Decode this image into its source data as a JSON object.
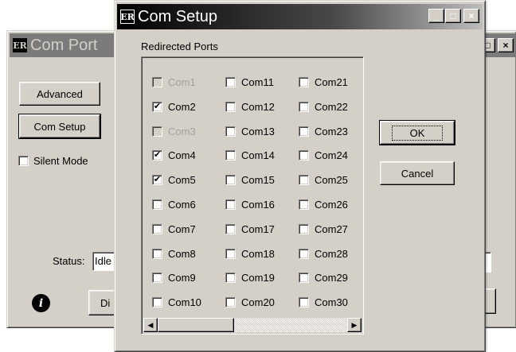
{
  "com_port_window": {
    "title": "Com Port",
    "buttons": {
      "advanced": "Advanced",
      "com_setup": "Com Setup",
      "disconnect_partial": "Di"
    },
    "silent_mode_label": "Silent Mode",
    "status_label": "Status:",
    "status_value": "Idle"
  },
  "dialog": {
    "title": "Com Setup",
    "group_label": "Redirected Ports",
    "ok_label": "OK",
    "cancel_label": "Cancel",
    "title_buttons": {
      "minimize": "_",
      "maximize": "□",
      "close": "×"
    },
    "ports": [
      {
        "label": "Com1",
        "checked": false,
        "disabled": true
      },
      {
        "label": "Com2",
        "checked": true,
        "disabled": false
      },
      {
        "label": "Com3",
        "checked": false,
        "disabled": true
      },
      {
        "label": "Com4",
        "checked": true,
        "disabled": false
      },
      {
        "label": "Com5",
        "checked": true,
        "disabled": false
      },
      {
        "label": "Com6",
        "checked": false,
        "disabled": false
      },
      {
        "label": "Com7",
        "checked": false,
        "disabled": false
      },
      {
        "label": "Com8",
        "checked": false,
        "disabled": false
      },
      {
        "label": "Com9",
        "checked": false,
        "disabled": false
      },
      {
        "label": "Com10",
        "checked": false,
        "disabled": false
      },
      {
        "label": "Com11",
        "checked": false,
        "disabled": false
      },
      {
        "label": "Com12",
        "checked": false,
        "disabled": false
      },
      {
        "label": "Com13",
        "checked": false,
        "disabled": false
      },
      {
        "label": "Com14",
        "checked": false,
        "disabled": false
      },
      {
        "label": "Com15",
        "checked": false,
        "disabled": false
      },
      {
        "label": "Com16",
        "checked": false,
        "disabled": false
      },
      {
        "label": "Com17",
        "checked": false,
        "disabled": false
      },
      {
        "label": "Com18",
        "checked": false,
        "disabled": false
      },
      {
        "label": "Com19",
        "checked": false,
        "disabled": false
      },
      {
        "label": "Com20",
        "checked": false,
        "disabled": false
      },
      {
        "label": "Com21",
        "checked": false,
        "disabled": false
      },
      {
        "label": "Com22",
        "checked": false,
        "disabled": false
      },
      {
        "label": "Com23",
        "checked": false,
        "disabled": false
      },
      {
        "label": "Com24",
        "checked": false,
        "disabled": false
      },
      {
        "label": "Com25",
        "checked": false,
        "disabled": false
      },
      {
        "label": "Com26",
        "checked": false,
        "disabled": false
      },
      {
        "label": "Com27",
        "checked": false,
        "disabled": false
      },
      {
        "label": "Com28",
        "checked": false,
        "disabled": false
      },
      {
        "label": "Com29",
        "checked": false,
        "disabled": false
      },
      {
        "label": "Com30",
        "checked": false,
        "disabled": false
      }
    ]
  },
  "icons": {
    "app_logo": "ER",
    "info": "i",
    "scroll_left": "◀",
    "scroll_right": "▶",
    "check": "✔"
  }
}
